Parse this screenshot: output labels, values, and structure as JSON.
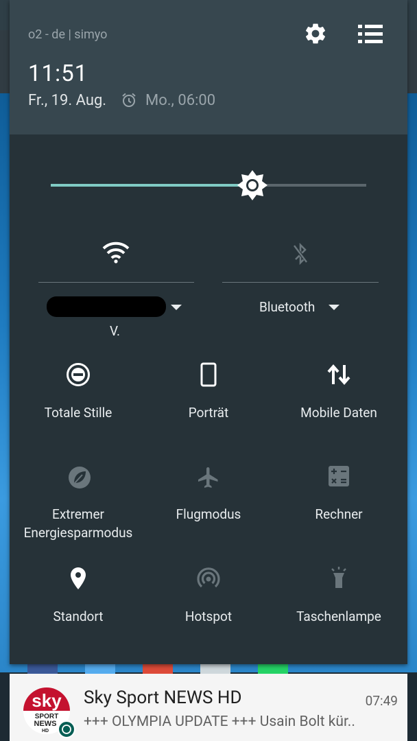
{
  "header": {
    "carrier": "o2 - de | simyo",
    "time": "11:51",
    "date": "Fr., 19. Aug.",
    "alarm": "Mo., 06:00"
  },
  "brightness": {
    "level": 0.64
  },
  "wifi": {
    "network_suffix": "V."
  },
  "bluetooth": {
    "label": "Bluetooth"
  },
  "tiles": {
    "total_silence": "Totale Stille",
    "portrait": "Porträt",
    "mobile_data": "Mobile Daten",
    "extreme_power_line1": "Extremer",
    "extreme_power_line2": "Energiesparmodus",
    "airplane": "Flugmodus",
    "calculator": "Rechner",
    "location": "Standort",
    "hotspot": "Hotspot",
    "flashlight": "Taschenlampe"
  },
  "notification": {
    "title": "Sky Sport NEWS HD",
    "time": "07:49",
    "text": "+++ OLYMPIA UPDATE +++  Usain Bolt kür..",
    "logo_text": "sky",
    "logo_sub1": "SPORT",
    "logo_sub2": "NEWS",
    "logo_sub3": "HD"
  },
  "colors": {
    "accent": "#80cbc4",
    "shade": "#263238",
    "header": "#37474f"
  }
}
